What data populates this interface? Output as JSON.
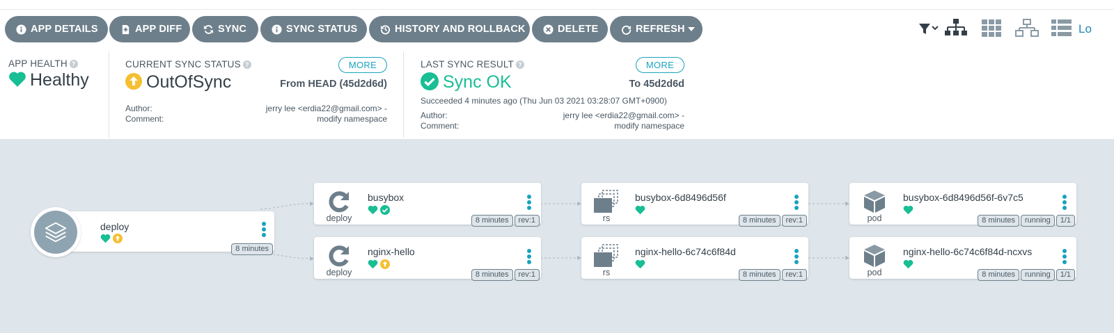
{
  "toolbar": {
    "buttons": [
      {
        "label": "APP DETAILS",
        "icon": "info-circle-icon"
      },
      {
        "label": "APP DIFF",
        "icon": "file-diff-icon"
      },
      {
        "label": "SYNC",
        "icon": "sync-icon"
      },
      {
        "label": "SYNC STATUS",
        "icon": "info-circle-icon"
      },
      {
        "label": "HISTORY AND ROLLBACK",
        "icon": "history-icon"
      },
      {
        "label": "DELETE",
        "icon": "times-circle-icon"
      },
      {
        "label": "REFRESH",
        "icon": "redo-icon",
        "dropdown": true
      }
    ],
    "view_icons": [
      "filter-icon",
      "tree-view-icon",
      "pods-grid-icon",
      "network-view-icon",
      "list-view-icon"
    ],
    "truncated_link": "Lo"
  },
  "status": {
    "health": {
      "label": "APP HEALTH",
      "value": "Healthy"
    },
    "sync": {
      "label": "CURRENT SYNC STATUS",
      "value": "OutOfSync",
      "more": "MORE",
      "revision": "From HEAD (45d2d6d)",
      "author_label": "Author:",
      "author_value": "jerry lee <erdia22@gmail.com> -",
      "comment_label": "Comment:",
      "comment_value": "modify namespace"
    },
    "last_sync": {
      "label": "LAST SYNC RESULT",
      "value": "Sync OK",
      "more": "MORE",
      "revision": "To 45d2d6d",
      "succeeded": "Succeeded 4 minutes ago (Thu Jun 03 2021 03:28:07 GMT+0900)",
      "author_label": "Author:",
      "author_value": "jerry lee <erdia22@gmail.com> -",
      "comment_label": "Comment:",
      "comment_value": "modify namespace"
    }
  },
  "colors": {
    "healthy": "#18be94",
    "out_of_sync": "#f4c030",
    "accent": "#18a3bd",
    "button_bg": "#6d7f8b"
  },
  "graph": {
    "app": {
      "name": "deploy",
      "age": "8 minutes"
    },
    "nodes": [
      {
        "name": "busybox",
        "kind": "deploy",
        "tags": [
          "8 minutes",
          "rev:1"
        ],
        "sync": "synced"
      },
      {
        "name": "nginx-hello",
        "kind": "deploy",
        "tags": [
          "8 minutes",
          "rev:1"
        ],
        "sync": "out-of-sync"
      },
      {
        "name": "busybox-6d8496d56f",
        "kind": "rs",
        "tags": [
          "8 minutes",
          "rev:1"
        ]
      },
      {
        "name": "nginx-hello-6c74c6f84d",
        "kind": "rs",
        "tags": [
          "8 minutes",
          "rev:1"
        ]
      },
      {
        "name": "busybox-6d8496d56f-6v7c5",
        "kind": "pod",
        "tags": [
          "8 minutes",
          "running",
          "1/1"
        ]
      },
      {
        "name": "nginx-hello-6c74c6f84d-ncxvs",
        "kind": "pod",
        "tags": [
          "8 minutes",
          "running",
          "1/1"
        ]
      }
    ]
  }
}
